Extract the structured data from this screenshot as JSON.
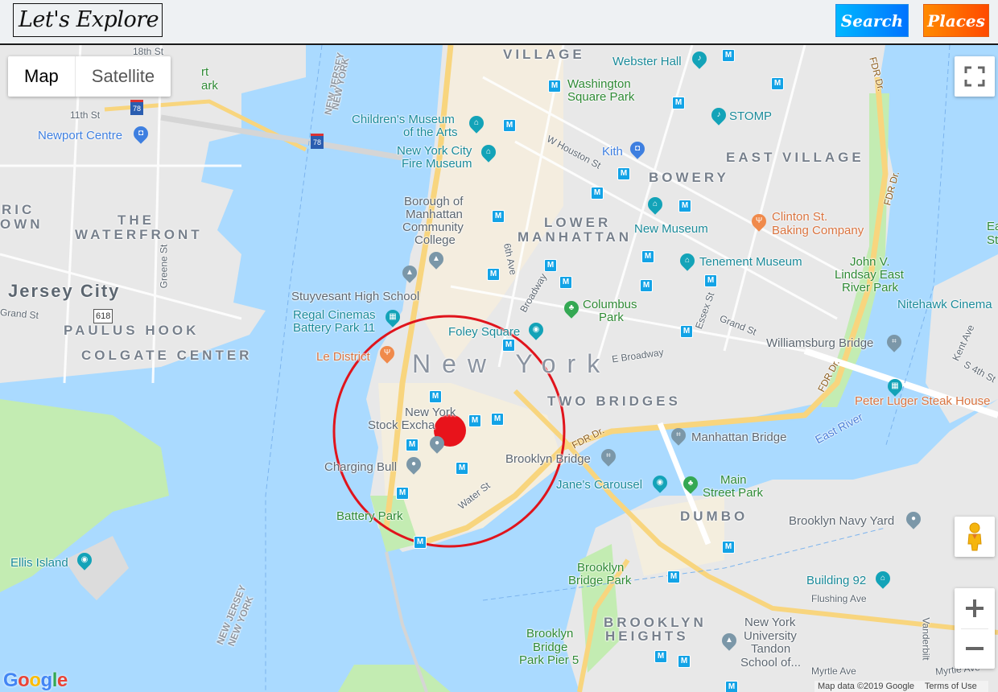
{
  "header": {
    "logo_text": "Let's Explore",
    "buttons": [
      {
        "label": "Search"
      },
      {
        "label": "Places"
      }
    ]
  },
  "map": {
    "map_type": {
      "options": [
        "Map",
        "Satellite"
      ],
      "selected": "Map"
    },
    "controls": {
      "fullscreen_icon": "fullscreen-icon",
      "pegman_icon": "street-view-pegman-icon",
      "zoom_in": "+",
      "zoom_out": "−"
    },
    "marker": {
      "color": "#e8131b",
      "radius_circle_color": "#e0141c"
    },
    "labels": {
      "big_city": "New York",
      "jersey_city": "Jersey City",
      "neighborhoods": [
        "VILLAGE",
        "THE",
        "WATERFRONT",
        "PAULUS HOOK",
        "COLGATE CENTER",
        "LOWER",
        "MANHATTAN",
        "BOWERY",
        "EAST VILLAGE",
        "TWO BRIDGES",
        "DUMBO",
        "BROOKLYN",
        "HEIGHTS",
        "RIC",
        "OWN"
      ],
      "pois": {
        "webster_hall": "Webster Hall",
        "washington_square_park_1": "Washington",
        "washington_square_park_2": "Square Park",
        "stomp": "STOMP",
        "childrens_museum_1": "Children's Museum",
        "childrens_museum_2": "of the Arts",
        "fire_museum_1": "New York City",
        "fire_museum_2": "Fire Museum",
        "kith": "Kith",
        "newport_centre": "Newport Centre",
        "bmcc_1": "Borough of",
        "bmcc_2": "Manhattan",
        "bmcc_3": "Community",
        "bmcc_4": "College",
        "new_museum": "New Museum",
        "clinton_1": "Clinton St.",
        "clinton_2": "Baking Company",
        "tenement_museum": "Tenement Museum",
        "lindsay_1": "John V.",
        "lindsay_2": "Lindsay East",
        "lindsay_3": "River Park",
        "nitehawk": "Nitehawk Cinema",
        "stuyvesant": "Stuyvesant High School",
        "regal_1": "Regal Cinemas",
        "regal_2": "Battery Park 11",
        "columbus_1": "Columbus",
        "columbus_2": "Park",
        "foley_square": "Foley Square",
        "williamsburg_bridge": "Williamsburg Bridge",
        "le_district": "Le District",
        "peter_luger": "Peter Luger Steak House",
        "nyse_1": "New York",
        "nyse_2": "Stock Excha",
        "manhattan_bridge": "Manhattan Bridge",
        "charging_bull": "Charging Bull",
        "brooklyn_bridge": "Brooklyn Bridge",
        "janes_carousel": "Jane's Carousel",
        "main_street_park_1": "Main",
        "main_street_park_2": "Street Park",
        "battery_park": "Battery Park",
        "brooklyn_navy_yard": "Brooklyn Navy Yard",
        "ellis_island": "Ellis Island",
        "bbp_1": "Brooklyn",
        "bbp_2": "Bridge Park",
        "building_92": "Building 92",
        "nyu_1": "New York",
        "nyu_2": "University",
        "nyu_3": "Tandon",
        "nyu_4": "School of...",
        "pier5_1": "Brooklyn",
        "pier5_2": "Bridge",
        "pier5_3": "Park Pier 5",
        "east_st_1": "Ea",
        "east_st_2": "St"
      },
      "streets": {
        "s18th": "18th St",
        "s11th": "11th St",
        "w_houston": "W Houston St",
        "sixth_ave": "6th Ave",
        "broadway": "Broadway",
        "essex": "Essex St",
        "grand_mh": "Grand St",
        "grand_jc": "Grand St",
        "e_broadway": "E Broadway",
        "greene": "Greene St",
        "water_st": "Water St",
        "fdr1": "FDR Dr.",
        "fdr2": "FDR Dr.",
        "fdr3": "FDR Dr.",
        "fdr4": "FDR Dr.",
        "kent": "Kent Ave",
        "s4th": "S 4th St",
        "flushing": "Flushing Ave",
        "myrtle1": "Myrtle Ave",
        "myrtle2": "Myrtle Ave",
        "vanderbilt": "Vanderbilt",
        "route_618": "618",
        "i78": "78",
        "park_frag_1": "rt",
        "park_frag_2": "ark"
      },
      "water": {
        "east_river": "East River"
      },
      "borders": {
        "nj": "NEW JERSEY",
        "ny": "NEW YORK"
      }
    },
    "branding": "Google",
    "attribution": {
      "map_data": "Map data ©2019 Google",
      "terms": "Terms of Use"
    }
  }
}
